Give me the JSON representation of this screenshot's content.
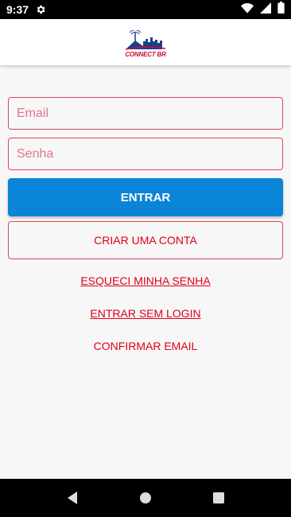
{
  "status_bar": {
    "time": "9:37",
    "icons": [
      "settings-gear-icon",
      "wifi-icon",
      "cellular-signal-icon",
      "battery-icon"
    ]
  },
  "header": {
    "logo_text": "CONNECT BR"
  },
  "form": {
    "email_placeholder": "Email",
    "email_value": "",
    "senha_placeholder": "Senha",
    "senha_value": ""
  },
  "buttons": {
    "entrar": "ENTRAR",
    "criar_conta": "CRIAR UMA CONTA"
  },
  "links": {
    "esqueci_senha": "ESQUECI MINHA SENHA",
    "entrar_sem_login": "ENTRAR SEM LOGIN",
    "confirmar_email": "CONFIRMAR EMAIL"
  },
  "nav": {
    "icons": [
      "back-icon",
      "home-icon",
      "recents-icon"
    ]
  },
  "colors": {
    "primary_blue": "#0a84d6",
    "accent_red": "#e0001a",
    "border_red": "#d9465a",
    "background": "#f7f7f7"
  }
}
